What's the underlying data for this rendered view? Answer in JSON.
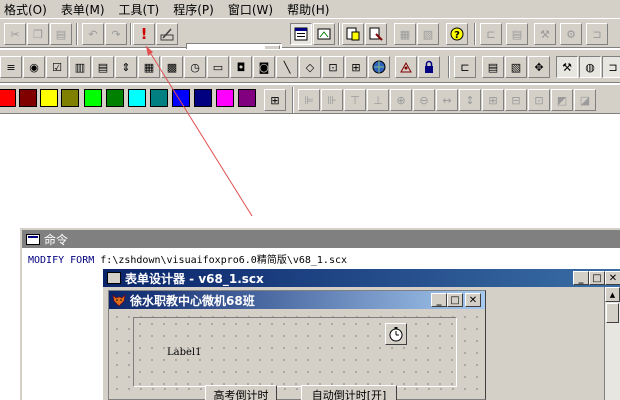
{
  "menubar": {
    "items": [
      "格式(O)",
      "表单(M)",
      "工具(T)",
      "程序(P)",
      "窗口(W)",
      "帮助(H)"
    ]
  },
  "toolbar": {
    "combo_value": ""
  },
  "palette": {
    "colors": [
      "#ff0000",
      "#800000",
      "#ffff00",
      "#808000",
      "#00ff00",
      "#008000",
      "#00ffff",
      "#008080",
      "#0000ff",
      "#000080",
      "#ff00ff",
      "#800080"
    ]
  },
  "command_window": {
    "title": "命令",
    "keyword1": "MODIFY",
    "keyword2": "FORM",
    "path": "f:\\zshdown\\visuaifoxpro6.0精简版\\v68_1.scx"
  },
  "form_designer": {
    "title": "表单设计器 - v68_1.scx"
  },
  "form": {
    "title": "徐水职教中心微机68班",
    "label": "Label1",
    "button1": "高考倒计时",
    "button2": "自动倒计时[开]"
  },
  "annotation": {
    "color": "#e05050"
  }
}
